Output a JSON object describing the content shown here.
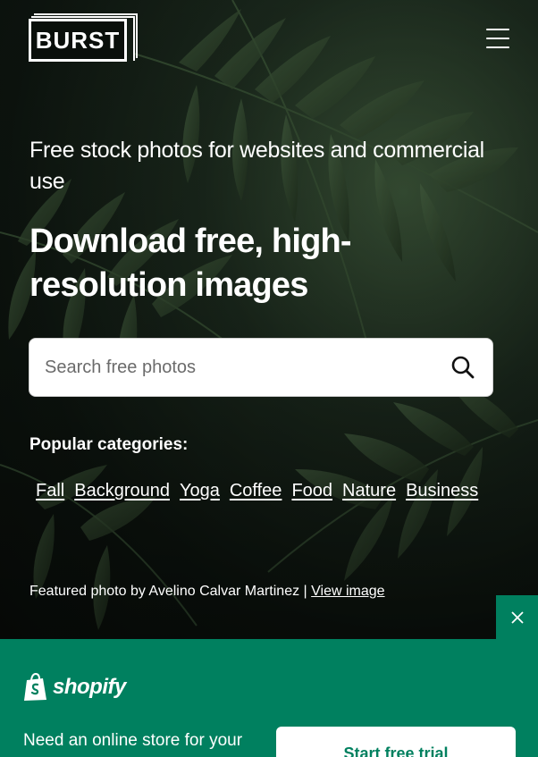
{
  "header": {
    "logo_text": "BURST",
    "menu_icon": "hamburger-menu-icon"
  },
  "hero": {
    "tagline": "Free stock photos for websites and commercial use",
    "headline": "Download free, high-resolution images"
  },
  "search": {
    "placeholder": "Search free photos",
    "value": "",
    "icon": "search-icon"
  },
  "popular": {
    "title": "Popular categories:",
    "categories": [
      "Fall",
      "Background",
      "Yoga",
      "Coffee",
      "Food",
      "Nature",
      "Business"
    ]
  },
  "credit": {
    "text": "Featured photo by Avelino Calvar Martinez | ",
    "link_label": "View image"
  },
  "banner": {
    "brand": "shopify",
    "text": "Need an online store for your",
    "button_label": "Start free trial",
    "close_icon": "close-icon",
    "background_color": "#00805f"
  }
}
